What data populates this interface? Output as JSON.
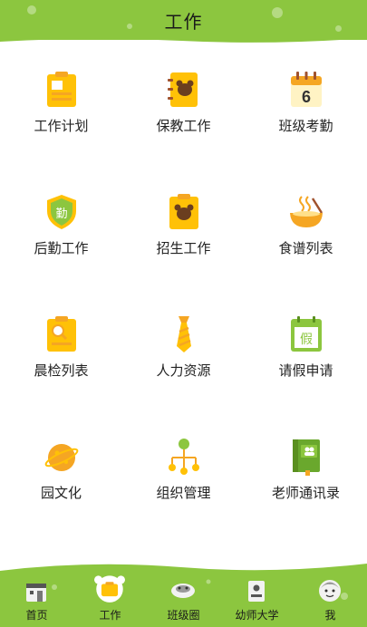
{
  "header": {
    "title": "工作"
  },
  "grid": [
    {
      "label": "工作计划",
      "icon": "work-plan-clipboard-icon"
    },
    {
      "label": "保教工作",
      "icon": "bear-notebook-icon"
    },
    {
      "label": "班级考勤",
      "icon": "calendar-icon",
      "calendar_day": "6"
    },
    {
      "label": "后勤工作",
      "icon": "logistics-shield-icon",
      "badge_text": "勤"
    },
    {
      "label": "招生工作",
      "icon": "bear-clipboard-icon"
    },
    {
      "label": "食谱列表",
      "icon": "food-bowl-icon"
    },
    {
      "label": "晨检列表",
      "icon": "magnifier-clipboard-icon"
    },
    {
      "label": "人力资源",
      "icon": "necktie-icon"
    },
    {
      "label": "请假申请",
      "icon": "leave-calendar-icon",
      "badge_text": "假"
    },
    {
      "label": "园文化",
      "icon": "planet-icon"
    },
    {
      "label": "组织管理",
      "icon": "org-chart-icon"
    },
    {
      "label": "老师通讯录",
      "icon": "contacts-book-icon"
    }
  ],
  "tabbar": [
    {
      "label": "首页",
      "icon": "house-icon",
      "active": false
    },
    {
      "label": "工作",
      "icon": "bear-briefcase-icon",
      "active": true
    },
    {
      "label": "班级圈",
      "icon": "class-circle-icon",
      "active": false
    },
    {
      "label": "幼师大学",
      "icon": "college-building-icon",
      "active": false
    },
    {
      "label": "我",
      "icon": "person-avatar-icon",
      "active": false
    }
  ],
  "colors": {
    "brand_green": "#8cc63f",
    "icon_yellow": "#ffc107",
    "icon_orange": "#f5a623"
  }
}
